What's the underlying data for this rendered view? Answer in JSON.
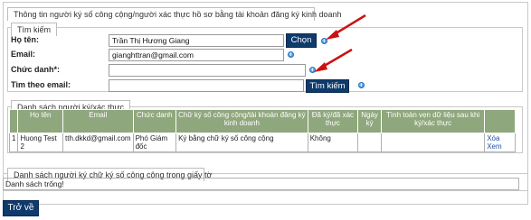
{
  "main_section": {
    "title": "Thông tin người ký số công cộng/người xác thực hồ sơ bằng tài khoản đăng ký kinh doanh"
  },
  "search": {
    "legend": "Tìm kiếm",
    "name_label": "Họ tên:",
    "name_value": "Trần Thị Hương Giang",
    "choose_button": "Chọn",
    "email_label": "Email:",
    "email_value": "gianghttran@gmail.com",
    "title_label": "Chức danh*:",
    "title_value": "",
    "find_by_email_label": "Tìm theo email:",
    "find_by_email_value": "",
    "search_button": "Tìm kiếm"
  },
  "signers": {
    "legend": "Danh sách người ký/xác thực",
    "columns": [
      "Họ tên",
      "Email",
      "Chức danh",
      "Chữ ký số công cộng/tài khoản đăng ký kinh doanh",
      "Đã ký/đã xác thực",
      "Ngày ký",
      "Tình toàn vẹn dữ liệu sau khi ký/xác thực"
    ],
    "rows": [
      {
        "index": "1",
        "name": "Huong Test 2",
        "email": "tth.dkkd@gmail.com",
        "position": "Phó Giám đốc",
        "signature": "Ký bằng chữ ký số công cộng",
        "signed": "Không",
        "date": "",
        "integrity": "",
        "delete_link": "Xóa",
        "view_link": "Xem"
      }
    ]
  },
  "document_signers": {
    "legend": "Danh sách người ký chữ ký số công cộng trong giấy tờ",
    "empty_text": "Danh sách trống!"
  },
  "back_button": "Trở về",
  "colors": {
    "button_bg": "#0e3b6b",
    "table_header": "#8fa77c",
    "arrow": "#cc1111",
    "help_icon": "#2f7fd3"
  },
  "icons": {
    "help": "info-help-icon",
    "arrow": "red-pointer-arrow"
  }
}
